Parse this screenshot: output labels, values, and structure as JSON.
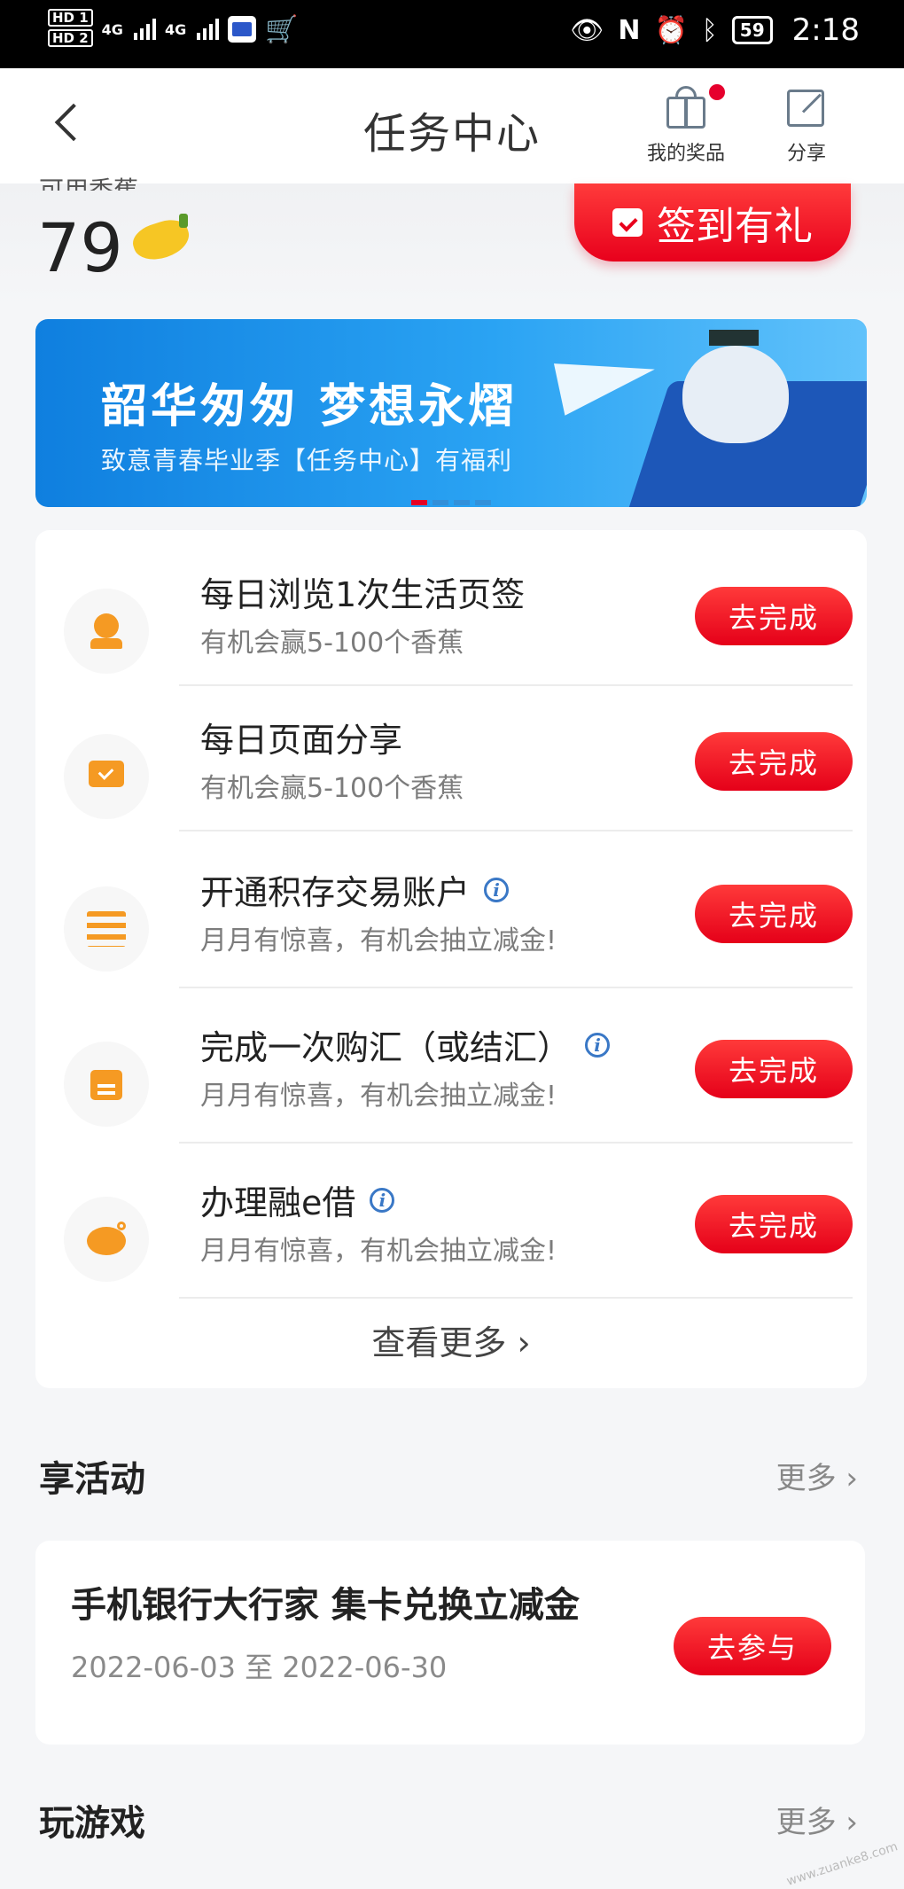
{
  "status_bar": {
    "hd1": "HD 1",
    "hd2": "HD 2",
    "net1": "4G",
    "net2": "4G",
    "battery": "59",
    "time": "2:18"
  },
  "header": {
    "title": "任务中心",
    "rewards_label": "我的奖品",
    "share_label": "分享"
  },
  "points": {
    "label": "可用香蕉",
    "value": "79",
    "checkin_label": "签到有礼"
  },
  "banner": {
    "title": "韶华匆匆 梦想永熠",
    "subtitle": "致意青春毕业季【任务中心】有福利",
    "page_count": 4,
    "active_page": 1
  },
  "tasks": [
    {
      "title": "每日浏览1次生活页签",
      "subtitle": "有机会赢5-100个香蕉",
      "button": "去完成",
      "icon": "avatar-icon",
      "info": false
    },
    {
      "title": "每日页面分享",
      "subtitle": "有机会赢5-100个香蕉",
      "button": "去完成",
      "icon": "screen-check-icon",
      "info": false
    },
    {
      "title": "开通积存交易账户",
      "subtitle": "月月有惊喜，有机会抽立减金!",
      "button": "去完成",
      "icon": "abacus-icon",
      "info": true
    },
    {
      "title": "完成一次购汇（或结汇）",
      "subtitle": "月月有惊喜，有机会抽立减金!",
      "button": "去完成",
      "icon": "calendar-icon",
      "info": true
    },
    {
      "title": "办理融e借",
      "subtitle": "月月有惊喜，有机会抽立减金!",
      "button": "去完成",
      "icon": "piggy-bank-icon",
      "info": true
    }
  ],
  "see_more": "查看更多",
  "activities": {
    "section_title": "享活动",
    "more_label": "更多",
    "card": {
      "title": "手机银行大行家 集卡兑换立减金",
      "date_range": "2022-06-03 至 2022-06-30",
      "button": "去参与"
    }
  },
  "games": {
    "section_title": "玩游戏",
    "more_label": "更多"
  },
  "watermark": "www.zuanke8.com",
  "colors": {
    "brand_red": "#e8001c",
    "icon_orange": "#f59a23",
    "banner_blue": "#1a8ee8"
  }
}
